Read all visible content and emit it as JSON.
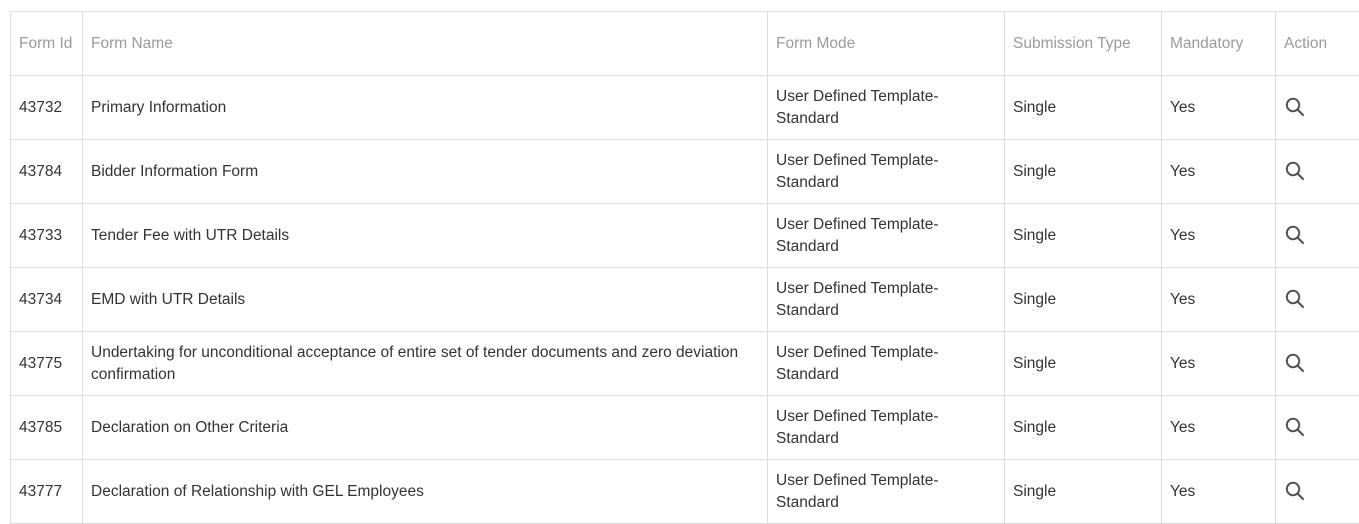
{
  "table": {
    "headers": {
      "form_id": "Form Id",
      "form_name": "Form Name",
      "form_mode": "Form Mode",
      "submission_type": "Submission Type",
      "mandatory": "Mandatory",
      "action": "Action"
    },
    "rows": [
      {
        "form_id": "43732",
        "form_name": "Primary Information",
        "form_mode": "User Defined Template-Standard",
        "submission_type": "Single",
        "mandatory": "Yes",
        "action_icon": "search-icon"
      },
      {
        "form_id": "43784",
        "form_name": "Bidder Information Form",
        "form_mode": "User Defined Template-Standard",
        "submission_type": "Single",
        "mandatory": "Yes",
        "action_icon": "search-icon"
      },
      {
        "form_id": "43733",
        "form_name": "Tender Fee with UTR Details",
        "form_mode": "User Defined Template-Standard",
        "submission_type": "Single",
        "mandatory": "Yes",
        "action_icon": "search-icon"
      },
      {
        "form_id": "43734",
        "form_name": "EMD with UTR Details",
        "form_mode": "User Defined Template-Standard",
        "submission_type": "Single",
        "mandatory": "Yes",
        "action_icon": "search-icon"
      },
      {
        "form_id": "43775",
        "form_name": "Undertaking for unconditional acceptance of entire set of tender documents and zero deviation confirmation",
        "form_mode": "User Defined Template-Standard",
        "submission_type": "Single",
        "mandatory": "Yes",
        "action_icon": "search-icon"
      },
      {
        "form_id": "43785",
        "form_name": "Declaration on Other Criteria",
        "form_mode": "User Defined Template-Standard",
        "submission_type": "Single",
        "mandatory": "Yes",
        "action_icon": "search-icon"
      },
      {
        "form_id": "43777",
        "form_name": "Declaration of Relationship with GEL Employees",
        "form_mode": "User Defined Template-Standard",
        "submission_type": "Single",
        "mandatory": "Yes",
        "action_icon": "search-icon"
      }
    ]
  },
  "colors": {
    "header_text": "#9b9b9b",
    "body_text": "#333333",
    "border": "#dddddd",
    "icon": "#555555"
  }
}
